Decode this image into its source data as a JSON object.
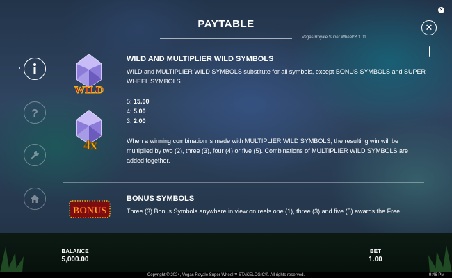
{
  "header": {
    "title": "PAYTABLE",
    "version": "Vegas Royale Super Wheel™ 1.01",
    "close_icon": "close-icon",
    "fullscreen_icon": "close-small-icon"
  },
  "sidebar": {
    "items": [
      {
        "name": "info",
        "icon": "info-icon",
        "active": true
      },
      {
        "name": "help",
        "icon": "question-icon",
        "active": false
      },
      {
        "name": "settings",
        "icon": "wrench-icon",
        "active": false
      },
      {
        "name": "home",
        "icon": "home-icon",
        "active": false
      }
    ]
  },
  "wild_section": {
    "title": "WILD AND MULTIPLIER WILD SYMBOLS",
    "description": "WILD and MULTIPLIER WILD SYMBOLS substitute for all symbols, except BONUS SYMBOLS and SUPER WHEEL SYMBOLS.",
    "wild_symbol_label": "WILD",
    "multiplier_symbol_label": "4x",
    "payouts": [
      {
        "count": "5:",
        "value": "15.00"
      },
      {
        "count": "4:",
        "value": "5.00"
      },
      {
        "count": "3:",
        "value": "2.00"
      }
    ],
    "multiplier_text": "When a winning combination is made with MULTIPLIER WILD SYMBOLS, the resulting win will be multiplied by two (2), three (3), four (4) or five (5). Combinations of MULTIPLIER WILD SYMBOLS are added together."
  },
  "bonus_section": {
    "title": "BONUS SYMBOLS",
    "symbol_label": "BONUS",
    "description": "Three (3) Bonus Symbols anywhere in view on reels one (1), three (3) and five (5) awards the Free"
  },
  "bottom": {
    "balance_label": "BALANCE",
    "balance_value": "5,000.00",
    "bet_label": "BET",
    "bet_value": "1.00",
    "copyright": "Copyright © 2024, Vegas Royale Super Wheel™ STAKELOGIC®. All rights reserved.",
    "clock": "9:46 PM"
  },
  "colors": {
    "accent_gold": "#f2b21b",
    "wild_red": "#c0171b",
    "gem_purple": "#8c7bd8"
  }
}
